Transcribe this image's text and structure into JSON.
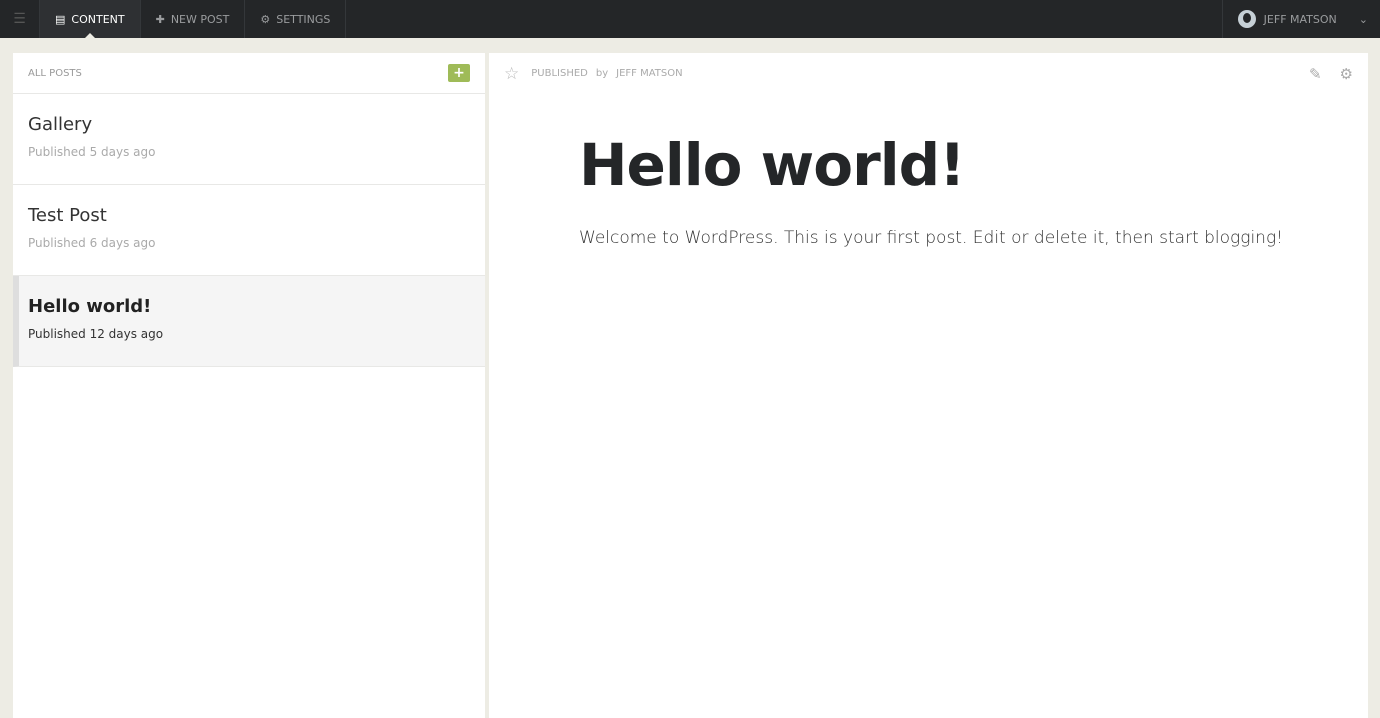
{
  "nav": {
    "tabs": [
      {
        "label": "CONTENT",
        "icon": "content-icon"
      },
      {
        "label": "NEW POST",
        "icon": "plus-icon"
      },
      {
        "label": "SETTINGS",
        "icon": "gears-icon"
      }
    ],
    "user": "JEFF MATSON"
  },
  "list": {
    "header": "ALL POSTS",
    "items": [
      {
        "title": "Gallery",
        "status": "Published 5 days ago"
      },
      {
        "title": "Test Post",
        "status": "Published 6 days ago"
      },
      {
        "title": "Hello world!",
        "status": "Published 12 days ago"
      }
    ]
  },
  "post": {
    "status": "PUBLISHED",
    "by": "by",
    "author": "JEFF MATSON",
    "title": "Hello world!",
    "body": "Welcome to WordPress. This is your first post. Edit or delete it, then start blogging!"
  }
}
